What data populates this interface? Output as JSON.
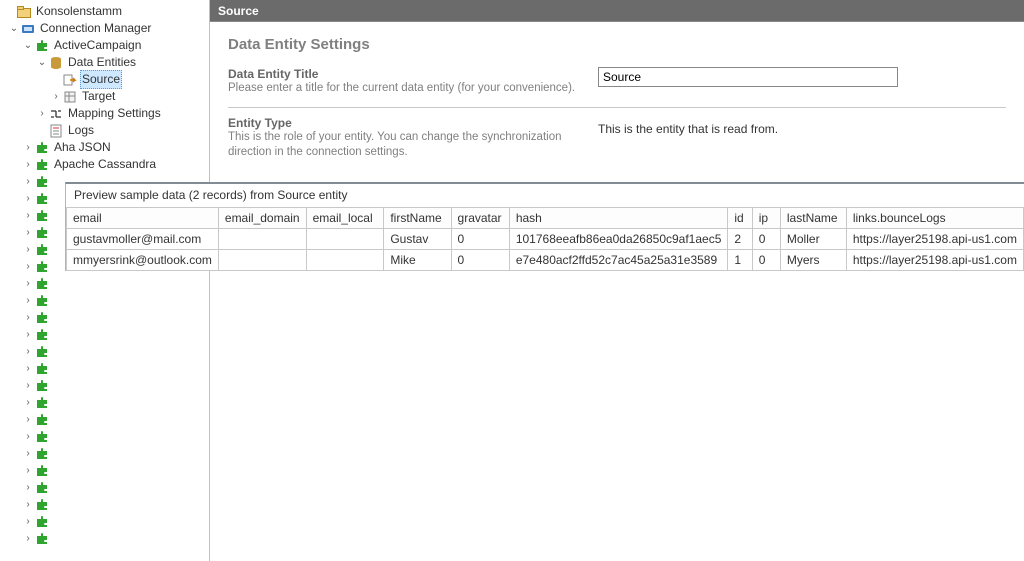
{
  "titlebar": {
    "label": "Source"
  },
  "tree": {
    "root": "Konsolenstamm",
    "cm": "Connection Manager",
    "ac": "ActiveCampaign",
    "de": "Data Entities",
    "src": "Source",
    "tgt": "Target",
    "map": "Mapping Settings",
    "logs": "Logs",
    "aha": "Aha JSON",
    "cass": "Apache Cassandra"
  },
  "settings": {
    "heading": "Data Entity Settings",
    "title_label": "Data Entity Title",
    "title_desc": "Please enter a title for the current data entity (for your convenience).",
    "title_value": "Source",
    "type_label": "Entity Type",
    "type_desc": "This is the role of your entity. You can change the synchronization direction in the connection settings.",
    "type_value": "This is the entity that is read from."
  },
  "preview": {
    "title": "Preview sample data (2 records) from Source entity",
    "columns": [
      "email",
      "email_domain",
      "email_local",
      "firstName",
      "gravatar",
      "hash",
      "id",
      "ip",
      "lastName",
      "links.bounceLogs"
    ],
    "rows": [
      {
        "email": "gustavmoller@mail.com",
        "email_domain": "",
        "email_local": "",
        "firstName": "Gustav",
        "gravatar": "0",
        "hash": "101768eeafb86ea0da26850c9af1aec5",
        "id": "2",
        "ip": "0",
        "lastName": "Moller",
        "links": "https://layer25198.api-us1.com"
      },
      {
        "email": "mmyersrink@outlook.com",
        "email_domain": "",
        "email_local": "",
        "firstName": "Mike",
        "gravatar": "0",
        "hash": "e7e480acf2ffd52c7ac45a25a31e3589",
        "id": "1",
        "ip": "0",
        "lastName": "Myers",
        "links": "https://layer25198.api-us1.com"
      }
    ]
  }
}
